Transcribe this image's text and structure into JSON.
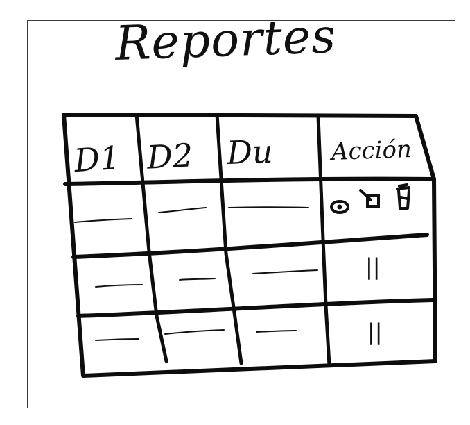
{
  "page": {
    "title": "Reportes"
  },
  "table": {
    "headers": [
      "D1",
      "D2",
      "Du",
      "Acción"
    ],
    "rows": [
      {
        "actions": [
          "view-icon",
          "edit-icon",
          "delete-icon"
        ]
      },
      {
        "actions_ditto": "||"
      },
      {
        "actions_ditto": "||"
      }
    ]
  }
}
